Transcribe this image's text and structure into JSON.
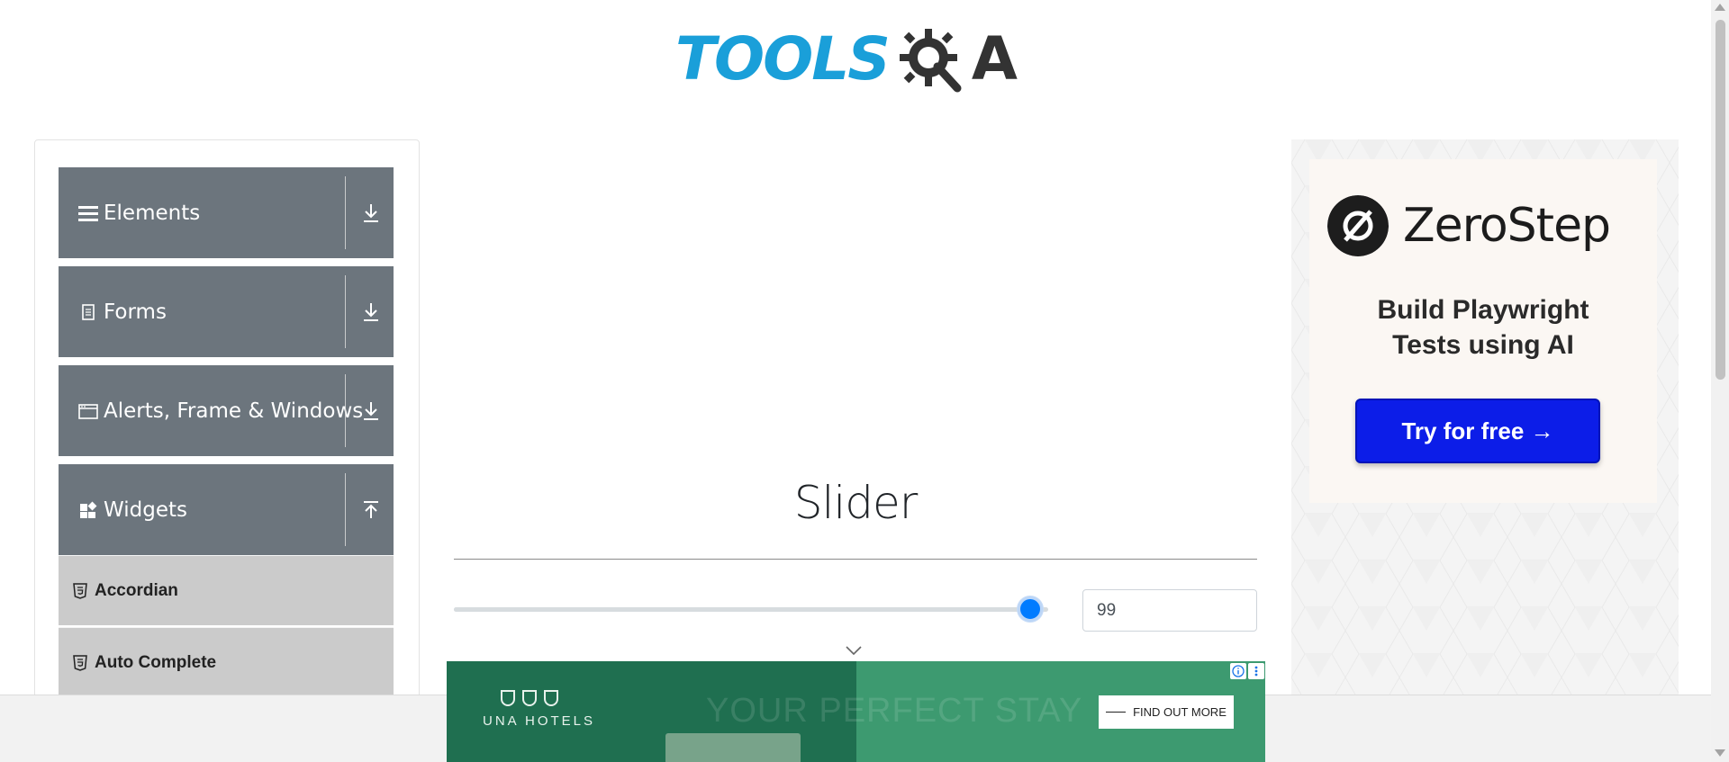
{
  "logo": {
    "tools": "TOOLS",
    "qa": "A"
  },
  "sidebar": {
    "groups": [
      {
        "label": "Elements",
        "icon": "hamburger-icon",
        "arrow": "download-arrow-icon"
      },
      {
        "label": "Forms",
        "icon": "document-icon",
        "arrow": "download-arrow-icon"
      },
      {
        "label": "Alerts, Frame & Windows",
        "icon": "window-icon",
        "arrow": "download-arrow-icon"
      },
      {
        "label": "Widgets",
        "icon": "widgets-icon",
        "arrow": "upload-arrow-icon"
      }
    ],
    "items": [
      {
        "label": "Accordian",
        "icon": "html5-icon"
      },
      {
        "label": "Auto Complete",
        "icon": "html5-icon"
      }
    ]
  },
  "main": {
    "title": "Slider",
    "slider": {
      "value": "99",
      "min": 0,
      "max": 100,
      "fraction": 0.99
    }
  },
  "right_ad": {
    "brand": "ZeroStep",
    "headline_line1": "Build Playwright",
    "headline_line2": "Tests using AI",
    "cta": "Try for free →"
  },
  "bottom_ad": {
    "hotels": "UNA HOTELS",
    "tagline": "YOUR PERFECT STAY",
    "cta": "FIND OUT MORE"
  },
  "colors": {
    "sidebar_group": "#6c757d",
    "sidebar_item": "#cbcbcb",
    "slider_thumb": "#007bff",
    "ad_cta": "#0c1de8",
    "logo_blue": "#1a9fd9",
    "bottom_ad_green": "#23805b"
  }
}
